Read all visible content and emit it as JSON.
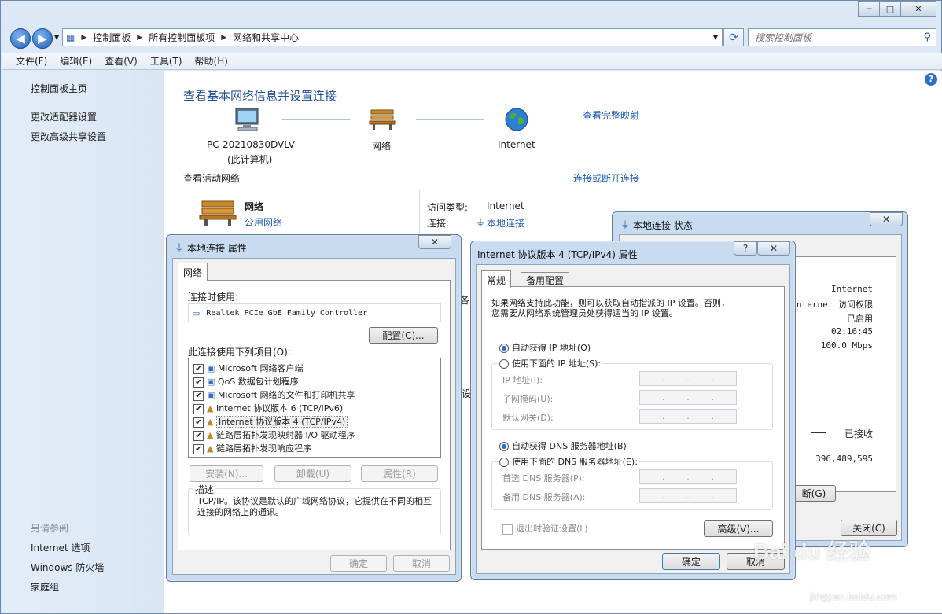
{
  "window": {
    "buttons": [
      "─",
      "□",
      "✕"
    ]
  },
  "address": {
    "crumbs": [
      "控制面板",
      "所有控制面板项",
      "网络和共享中心"
    ]
  },
  "search": {
    "placeholder": "搜索控制面板"
  },
  "menu": [
    "文件(F)",
    "编辑(E)",
    "查看(V)",
    "工具(T)",
    "帮助(H)"
  ],
  "sidebar": {
    "home": "控制面板主页",
    "links": [
      "更改适配器设置",
      "更改高级共享设置"
    ],
    "see_also_title": "另请参阅",
    "see_also": [
      "Internet 选项",
      "Windows 防火墙",
      "家庭组"
    ]
  },
  "main": {
    "heading": "查看基本网络信息并设置连接",
    "full_map": "查看完整映射",
    "computer": [
      "PC-20210830DVLV",
      "(此计算机)"
    ],
    "network_label": "网络",
    "internet_label": "Internet",
    "active_title": "查看活动网络",
    "connect_link": "连接或断开连接",
    "active_name": "网络",
    "active_type": "公用网络",
    "access_type_label": "访问类型:",
    "access_type_value": "Internet",
    "connections_label": "连接:",
    "connections_value": "本地连接",
    "partial_1": "各",
    "partial_2": "设"
  },
  "props_dialog": {
    "title": "本地连接 属性",
    "tab": "网络",
    "connect_using": "连接时使用:",
    "adapter": "Realtek PCIe GbE Family Controller",
    "configure": "配置(C)...",
    "items_title": "此连接使用下列项目(O):",
    "items": [
      "Microsoft 网络客户端",
      "QoS 数据包计划程序",
      "Microsoft 网络的文件和打印机共享",
      "Internet 协议版本 6 (TCP/IPv6)",
      "Internet 协议版本 4 (TCP/IPv4)",
      "链路层拓扑发现映射器 I/O 驱动程序",
      "链路层拓扑发现响应程序"
    ],
    "install": "安装(N)...",
    "uninstall": "卸载(U)",
    "properties": "属性(R)",
    "desc_title": "描述",
    "desc_text": "TCP/IP。该协议是默认的广域网络协议，它提供在不同的相互连接的网络上的通讯。",
    "ok": "确定",
    "cancel": "取消"
  },
  "status_dialog": {
    "title": "本地连接 状态",
    "values": [
      "Internet",
      "Internet 访问权限",
      "已启用",
      "02:16:45",
      "100.0 Mbps"
    ],
    "received_label": "已接收",
    "received_value": "396,489,595",
    "disable_partial": "断(G)",
    "close": "关闭(C)"
  },
  "ipv4_dialog": {
    "title": "Internet 协议版本 4 (TCP/IPv4) 属性",
    "help": "?",
    "tabs": [
      "常规",
      "备用配置"
    ],
    "intro_1": "如果网络支持此功能，则可以获取自动指派的 IP 设置。否则，",
    "intro_2": "您需要从网络系统管理员处获得适当的 IP 设置。",
    "auto_ip": "自动获得 IP 地址(O)",
    "manual_ip": "使用下面的 IP 地址(S):",
    "ip_fields": [
      "IP 地址(I):",
      "子网掩码(U):",
      "默认网关(D):"
    ],
    "auto_dns": "自动获得 DNS 服务器地址(B)",
    "manual_dns": "使用下面的 DNS 服务器地址(E):",
    "dns_fields": [
      "首选 DNS 服务器(P):",
      "备用 DNS 服务器(A):"
    ],
    "validate": "退出时验证设置(L)",
    "advanced": "高级(V)...",
    "ok": "确定",
    "cancel": "取消"
  },
  "watermark": {
    "text": "Bai du 经验",
    "url": "jingyan.baidu.com"
  }
}
